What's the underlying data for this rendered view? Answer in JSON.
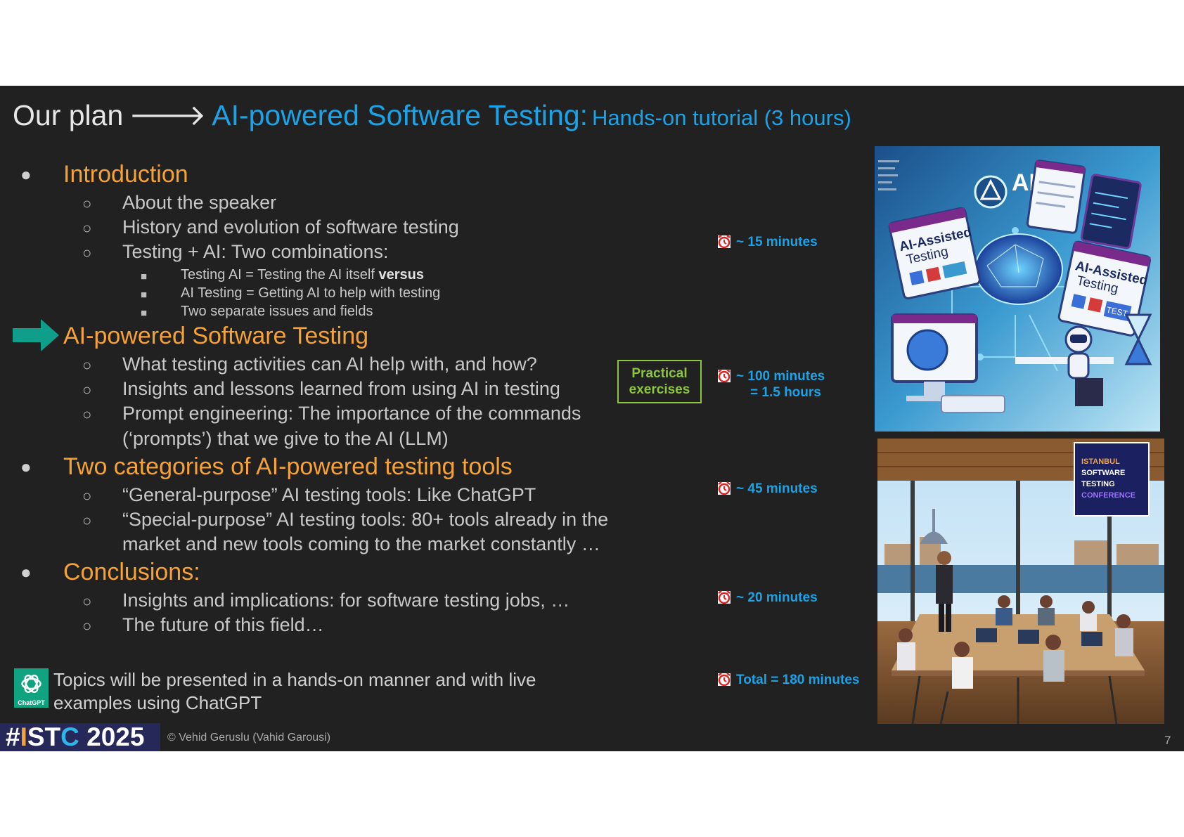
{
  "title": {
    "prefix": "Our plan",
    "arrow": "🡒",
    "main": "AI-powered Software Testing:",
    "sub": "Hands-on tutorial (3 hours)"
  },
  "outline": {
    "introduction": {
      "label": "Introduction",
      "items": [
        "About the speaker",
        "History and evolution of software testing",
        "Testing + AI: Two combinations:"
      ],
      "subitems": [
        {
          "text": "Testing AI = Testing the AI itself ",
          "bold": "versus"
        },
        {
          "text": "AI Testing = Getting AI to help with testing",
          "bold": ""
        },
        {
          "text": "Two separate issues and fields",
          "bold": ""
        }
      ]
    },
    "ai_testing": {
      "label": "AI-powered Software Testing",
      "items": [
        "What testing activities can AI help with, and how?",
        "Insights and lessons learned from using AI in testing",
        "Prompt engineering: The importance of the commands",
        "(‘prompts’) that we give to the AI (LLM)"
      ]
    },
    "tools": {
      "label": "Two categories of AI-powered testing tools",
      "items": [
        "“General-purpose” AI testing tools: Like ChatGPT",
        "“Special-purpose” AI testing tools: 80+ tools already in the",
        "market and new tools coming to the market constantly …"
      ]
    },
    "conclusions": {
      "label": "Conclusions:",
      "items": [
        "Insights and implications: for software testing jobs, …",
        "The future of this field…"
      ]
    }
  },
  "bullets": {
    "l1": "●",
    "l2": "○",
    "l3": "■"
  },
  "practical": {
    "line1": "Practical",
    "line2": "exercises"
  },
  "timings": {
    "intro": "~ 15 minutes",
    "ai_line1": "~ 100 minutes",
    "ai_line2": "= 1.5 hours",
    "tools": "~ 45 minutes",
    "conclusions": "~ 20 minutes",
    "total": "Total = 180 minutes"
  },
  "images": {
    "top": {
      "tag_ai": "AI",
      "tag_left": "AI-Assisted",
      "tag_left2": "Testing",
      "tag_right": "AI-Assisted",
      "tag_right2": "Testing",
      "test": "TEST"
    },
    "bottom": {
      "sign1": "ISTANBUL",
      "sign2": "SOFTWARE",
      "sign3": "TESTING",
      "sign4": "CONFERENCE"
    }
  },
  "note": {
    "line1": "Topics will be presented in a hands-on manner and with live",
    "line2": "examples using ChatGPT",
    "logo_caption": "ChatGPT"
  },
  "footer": {
    "hash": "#",
    "i": "I",
    "st": "ST",
    "c": "C",
    "year": " 2025",
    "copyright": "© Vehid Geruslu (Vahid Garousi)",
    "page": "7"
  },
  "colors": {
    "accent_orange": "#f7a234",
    "accent_blue": "#1aa3e8",
    "accent_green": "#8cc63f",
    "background": "#212121",
    "teal_arrow": "#0e9e8a"
  }
}
